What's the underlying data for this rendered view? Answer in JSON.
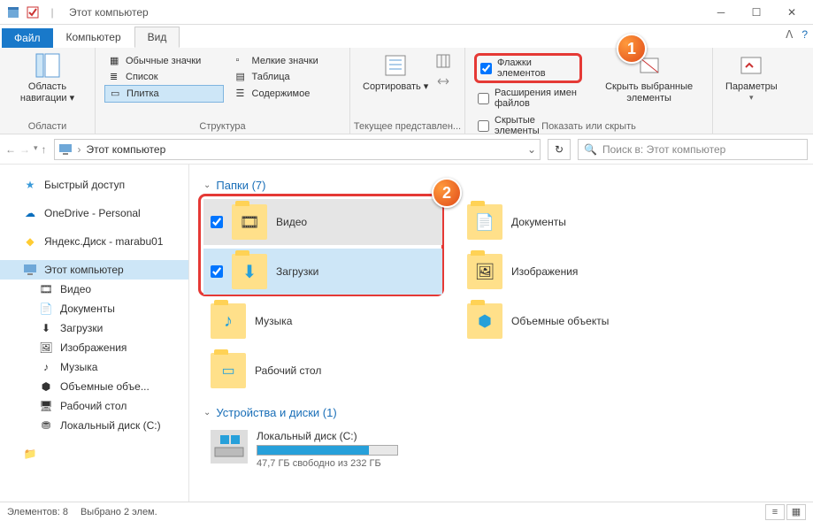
{
  "title": "Этот компьютер",
  "tabs": {
    "file": "Файл",
    "computer": "Компьютер",
    "view": "Вид"
  },
  "ribbon": {
    "panes": {
      "label": "Область навигации ▾",
      "group": "Области"
    },
    "layout": {
      "items": [
        "Обычные значки",
        "Мелкие значки",
        "Список",
        "Таблица",
        "Плитка",
        "Содержимое"
      ],
      "group": "Структура"
    },
    "current": {
      "sort": "Сортировать ▾",
      "group": "Текущее представлен..."
    },
    "show": {
      "flags": "Флажки элементов",
      "ext": "Расширения имен файлов",
      "hidden": "Скрытые элементы",
      "hide_btn": "Скрыть выбранные элементы",
      "group": "Показать или скрыть"
    },
    "options": "Параметры"
  },
  "address": {
    "path": "Этот компьютер",
    "search_ph": "Поиск в: Этот компьютер"
  },
  "sidebar": {
    "quick": "Быстрый доступ",
    "onedrive": "OneDrive - Personal",
    "yadisk": "Яндекс.Диск - marabu01",
    "thispc": "Этот компьютер",
    "children": [
      "Видео",
      "Документы",
      "Загрузки",
      "Изображения",
      "Музыка",
      "Объемные объе...",
      "Рабочий стол",
      "Локальный диск (C:)"
    ]
  },
  "content": {
    "folders_head": "Папки (7)",
    "folders": [
      {
        "name": "Видео",
        "checked": true,
        "state": "hover"
      },
      {
        "name": "Документы"
      },
      {
        "name": "Загрузки",
        "checked": true,
        "state": "selected"
      },
      {
        "name": "Изображения"
      },
      {
        "name": "Музыка"
      },
      {
        "name": "Объемные объекты"
      },
      {
        "name": "Рабочий стол"
      }
    ],
    "drives_head": "Устройства и диски (1)",
    "drive": {
      "name": "Локальный диск (C:)",
      "free": "47,7 ГБ свободно из 232 ГБ",
      "pct": 80
    }
  },
  "status": {
    "count": "Элементов: 8",
    "sel": "Выбрано 2 элем."
  },
  "badges": {
    "b1": "1",
    "b2": "2"
  }
}
